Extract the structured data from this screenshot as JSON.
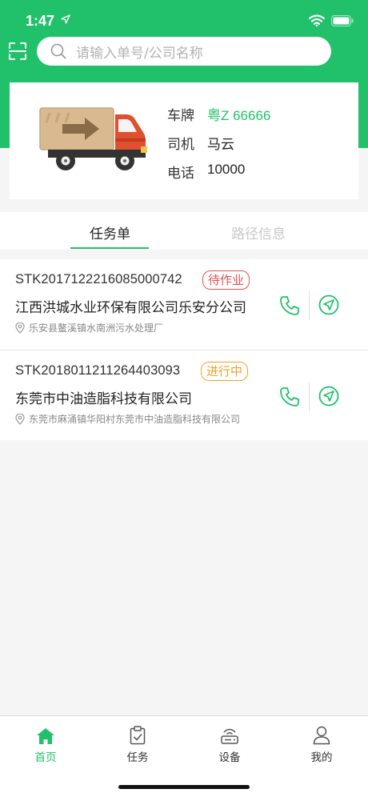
{
  "status_bar": {
    "time": "1:47"
  },
  "search": {
    "placeholder": "请输入单号/公司名称"
  },
  "vehicle": {
    "plate_label": "车牌",
    "plate": "粤Z 66666",
    "driver_label": "司机",
    "driver": "马云",
    "phone_label": "电话",
    "phone": "10000"
  },
  "tabs": [
    {
      "label": "任务单",
      "active": true
    },
    {
      "label": "路径信息",
      "active": false
    }
  ],
  "tasks": [
    {
      "code": "STK2017122216085000742",
      "status": "待作业",
      "status_color": "#e84f4f",
      "company": "江西洪城水业环保有限公司乐安分公司",
      "address": "乐安县鳌溪镇水南洲污水处理厂"
    },
    {
      "code": "STK2018011211264403093",
      "status": "进行中",
      "status_color": "#f0a22a",
      "company": "东莞市中油造脂科技有限公司",
      "address": "东莞市麻涌镇华阳村东莞市中油造脂科技有限公司"
    }
  ],
  "tabbar": [
    {
      "label": "首页",
      "icon": "home-icon",
      "active": true
    },
    {
      "label": "任务",
      "icon": "clipboard-check-icon",
      "active": false
    },
    {
      "label": "设备",
      "icon": "device-icon",
      "active": false
    },
    {
      "label": "我的",
      "icon": "user-icon",
      "active": false
    }
  ],
  "colors": {
    "brand": "#21c16b",
    "pending": "#e84f4f",
    "in_progress": "#f0a22a"
  }
}
